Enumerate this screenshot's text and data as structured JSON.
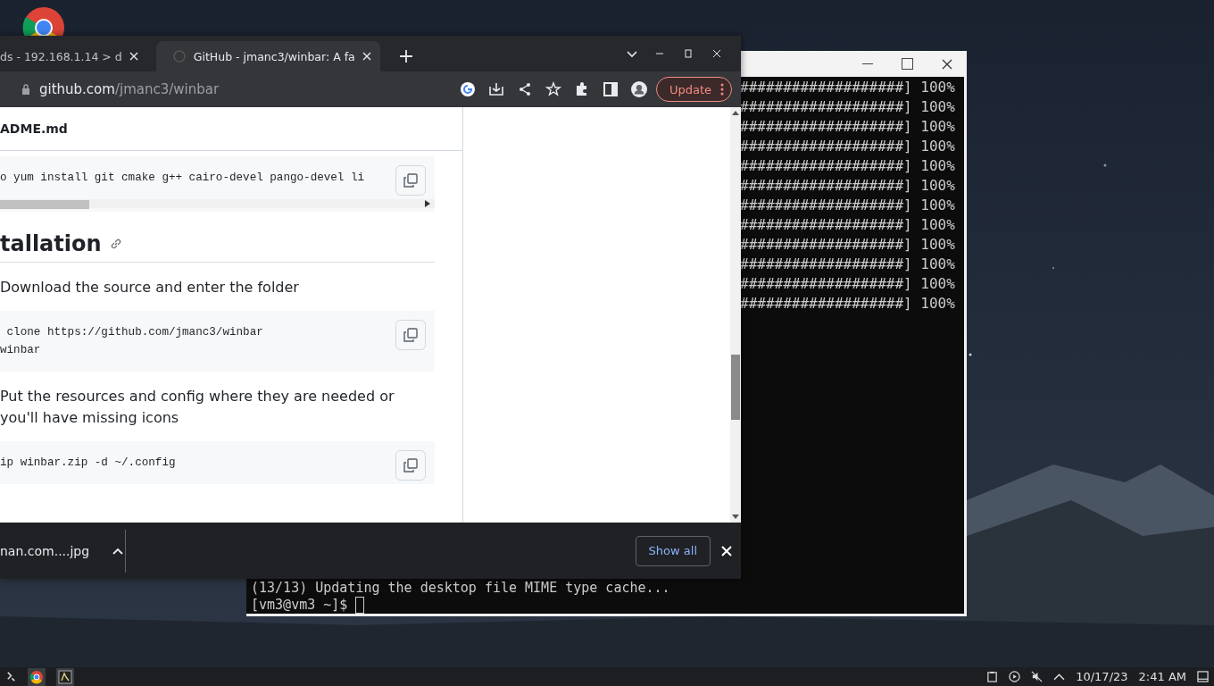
{
  "browser": {
    "tabs": [
      {
        "title": "ds - 192.168.1.14 > d",
        "selected": false
      },
      {
        "title": "GitHub - jmanc3/winbar: A fa",
        "selected": true
      }
    ],
    "url": {
      "host": "github.com",
      "path": "/jmanc3/winbar"
    },
    "update_button": "Update",
    "readme": {
      "file_title": "ADME.md",
      "blocks": [
        {
          "kind": "wide_code",
          "lines": [
            "o yum install git cmake g++ cairo-devel pango-devel li"
          ]
        },
        {
          "kind": "heading",
          "text": "tallation"
        },
        {
          "kind": "para",
          "text": "Download the source and enter the folder"
        },
        {
          "kind": "code",
          "lines": [
            " clone https://github.com/jmanc3/winbar",
            "winbar"
          ]
        },
        {
          "kind": "para",
          "text": "Put the resources and config where they are needed or you'll have missing icons"
        },
        {
          "kind": "code",
          "lines": [
            "ip winbar.zip -d ~/.config"
          ]
        }
      ]
    },
    "download": {
      "file": "nan.com....jpg",
      "show_all": "Show all"
    }
  },
  "terminal": {
    "progress_lines": [
      "###################] 100%",
      "###################] 100%",
      "###################] 100%",
      "###################] 100%",
      "###################] 100%",
      "###################] 100%",
      "###################] 100%",
      "###################] 100%",
      "###################] 100%",
      "###################] 100%",
      "###################] 100%",
      "###################] 100%"
    ],
    "output_lines": [
      "(13/13) Updating the desktop file MIME type cache...",
      "[vm3@vm3 ~]$ "
    ]
  },
  "taskbar": {
    "date": "10/17/23",
    "time": "2:41 AM"
  }
}
